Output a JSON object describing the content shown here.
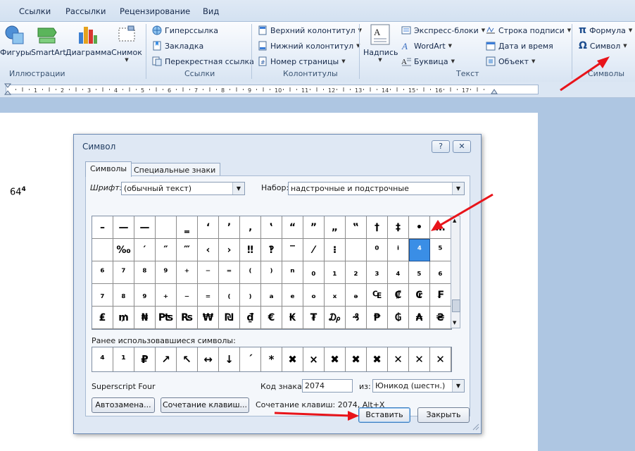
{
  "ribbon": {
    "tabs": [
      "Ссылки",
      "Рассылки",
      "Рецензирование",
      "Вид"
    ],
    "illustrations": {
      "buttons": [
        "Фигуры",
        "SmartArt",
        "Диаграмма",
        "Снимок"
      ],
      "group_label": "Иллюстрации"
    },
    "links": {
      "items": [
        "Гиперссылка",
        "Закладка",
        "Перекрестная ссылка"
      ],
      "group_label": "Ссылки"
    },
    "headers": {
      "items": [
        "Верхний колонтитул",
        "Нижний колонтитул",
        "Номер страницы"
      ],
      "group_label": "Колонтитулы"
    },
    "text": {
      "big_button": "Надпись",
      "col1": [
        "Экспресс-блоки",
        "WordArt",
        "Буквица"
      ],
      "col2": [
        "Строка подписи",
        "Дата и время",
        "Объект"
      ],
      "group_label": "Текст"
    },
    "symbols": {
      "formula": "Формула",
      "symbol": "Символ",
      "group_label": "Символы",
      "formula_glyph": "π",
      "symbol_glyph": "Ω"
    }
  },
  "ruler": {
    "numbers": [
      "1",
      "2",
      "3",
      "4",
      "5",
      "6",
      "7",
      "8",
      "9",
      "10",
      "11",
      "12",
      "13",
      "14",
      "15",
      "16",
      "17"
    ]
  },
  "document": {
    "base": "64",
    "superscript": "4"
  },
  "dialog": {
    "title": "Символ",
    "help": "?",
    "close": "✕",
    "tabs": [
      "Символы",
      "Специальные знаки"
    ],
    "font_label": "Шрифт:",
    "font_value": "(обычный текст)",
    "subset_label": "Набор:",
    "subset_value": "надстрочные и подстрочные",
    "grid": [
      [
        "–",
        "—",
        "—",
        "",
        "‗",
        "‘",
        "’",
        "‚",
        "‛",
        "“",
        "”",
        "„",
        "‟",
        "†",
        "‡",
        "•",
        "…"
      ],
      [
        "",
        "‰",
        "′",
        "″",
        "‴",
        "‹",
        "›",
        "‼",
        "‽",
        "‾",
        "⁄",
        "⁝",
        "",
        "⁰",
        "ⁱ",
        "⁴",
        "⁵"
      ],
      [
        "⁶",
        "⁷",
        "⁸",
        "⁹",
        "⁺",
        "⁻",
        "⁼",
        "⁽",
        "⁾",
        "ⁿ",
        "₀",
        "₁",
        "₂",
        "₃",
        "₄",
        "₅",
        "₆"
      ],
      [
        "₇",
        "₈",
        "₉",
        "₊",
        "₋",
        "₌",
        "₍",
        "₎",
        "ₐ",
        "ₑ",
        "ₒ",
        "ₓ",
        "ₔ",
        "₠",
        "₡",
        "₢",
        "₣"
      ],
      [
        "₤",
        "₥",
        "₦",
        "₧",
        "₨",
        "₩",
        "₪",
        "₫",
        "€",
        "₭",
        "₮",
        "₯",
        "₰",
        "₱",
        "₲",
        "₳",
        "₴"
      ]
    ],
    "selected": "⁴",
    "recent_label": "Ранее использовавшиеся символы:",
    "recent": [
      "⁴",
      "¹",
      "₽",
      "↗",
      "↖",
      "↔",
      "↓",
      "´",
      "*",
      "✖",
      "×",
      "✖",
      "✖",
      "✖",
      "✕",
      "✕",
      "✕"
    ],
    "char_name": "Superscript Four",
    "code_label": "Код знака:",
    "code_value": "2074",
    "from_label": "из:",
    "from_value": "Юникод (шестн.)",
    "autocorrect": "Автозамена...",
    "shortcut_btn": "Сочетание клавиш...",
    "shortcut_info": "Сочетание клавиш: 2074, Alt+X",
    "insert": "Вставить",
    "close_btn": "Закрыть"
  },
  "colors": {
    "arrow": "#e8141a",
    "selected_cell": "#3a8ee6",
    "ribbon_bg": "#dfe9f5"
  }
}
